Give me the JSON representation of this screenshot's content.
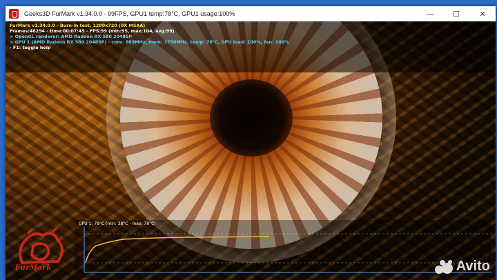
{
  "window": {
    "title": "Geeks3D FurMark v1.34.0.0 - 99FPS, GPU1 temp:78°C, GPU1 usage:100%",
    "minimize_glyph": "—",
    "maximize_glyph": "☐",
    "close_glyph": "✕",
    "icon": "furmark-app-icon"
  },
  "hud": {
    "line1": "FurMark v1.34.0.0 - Burn-in test, 1280x720 (0X MSAA)",
    "line2": "Frames:46294 - time:00:07:45 - FPS:99 (min:95, max:104, avg:99)",
    "line3": "> OpenGL renderer: AMD Radeon RX 580 2048SP",
    "line4": "> GPU 1 (AMD Radeon RX 580 2048SP) - core: 889MHz, mem: 1750MHz, temp: 78°C, GPU load: 100%, fan: 100%",
    "line5": "- F1: toggle help"
  },
  "graph": {
    "label": "GPU 1: 78°C (min: 38°C - max: 78°C)",
    "line_color": "#f5b84a",
    "axis_color": "#5aa0ff"
  },
  "logo": {
    "text": "FurMark",
    "color": "#e02a1c"
  },
  "watermark": {
    "text": "Avito"
  }
}
